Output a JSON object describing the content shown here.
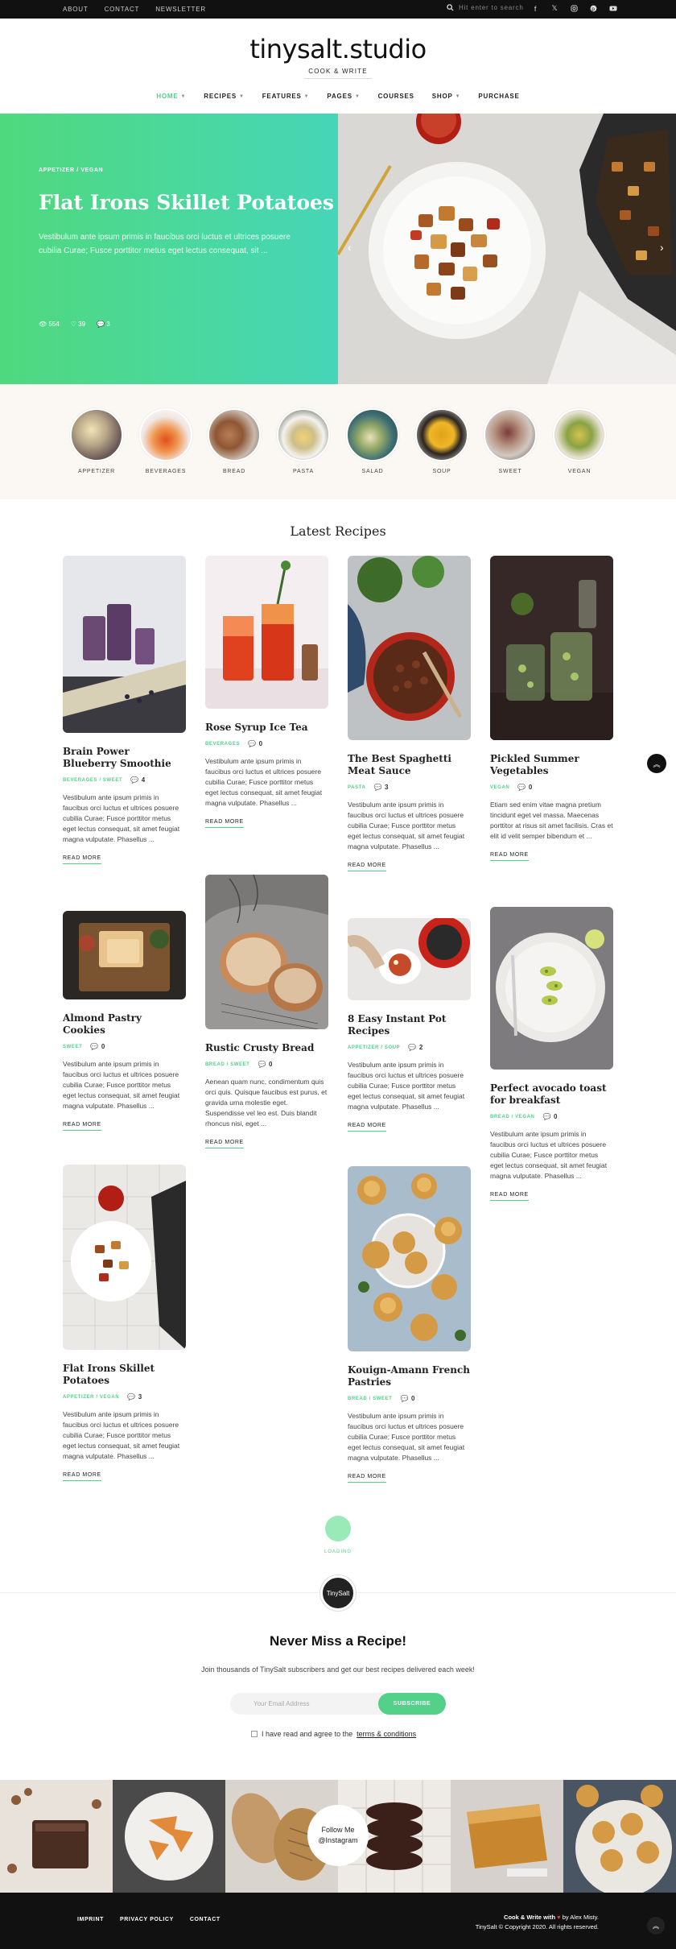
{
  "topbar": {
    "links": [
      "ABOUT",
      "CONTACT",
      "NEWSLETTER"
    ],
    "search_placeholder": "Hit enter to search"
  },
  "header": {
    "logo": "tinysalt.studio",
    "tagline": "COOK & WRITE"
  },
  "nav": [
    {
      "label": "HOME",
      "dropdown": true,
      "active": true
    },
    {
      "label": "RECIPES",
      "dropdown": true
    },
    {
      "label": "FEATURES",
      "dropdown": true
    },
    {
      "label": "PAGES",
      "dropdown": true
    },
    {
      "label": "COURSES",
      "dropdown": false
    },
    {
      "label": "SHOP",
      "dropdown": true
    },
    {
      "label": "PURCHASE",
      "dropdown": false
    }
  ],
  "hero": {
    "category": "APPETIZER / VEGAN",
    "title": "Flat Irons Skillet Potatoes",
    "excerpt": "Vestibulum ante ipsum primis in faucibus orci luctus et ultrices posuere cubilia Curae; Fusce porttitor metus eget lectus consequat, sit ...",
    "views": "554",
    "likes": "39",
    "comments": "3"
  },
  "categories": [
    "APPETIZER",
    "BEVERAGES",
    "BREAD",
    "PASTA",
    "SALAD",
    "SOUP",
    "SWEET",
    "VEGAN"
  ],
  "latest": {
    "title": "Latest Recipes",
    "read_more": "READ MORE",
    "cards": [
      {
        "title": "Brain Power Blueberry Smoothie",
        "category": "BEVERAGES / SWEET",
        "comments": "4",
        "excerpt": "Vestibulum ante ipsum primis in faucibus orci luctus et ultrices posuere cubilia Curae; Fusce porttitor metus eget lectus consequat, sit amet feugiat magna vulputate. Phasellus ..."
      },
      {
        "title": "Rose Syrup Ice Tea",
        "category": "BEVERAGES",
        "comments": "0",
        "excerpt": "Vestibulum ante ipsum primis in faucibus orci luctus et ultrices posuere cubilia Curae; Fusce porttitor metus eget lectus consequat, sit amet feugiat magna vulputate. Phasellus ..."
      },
      {
        "title": "The Best Spaghetti Meat Sauce",
        "category": "PASTA",
        "comments": "3",
        "excerpt": "Vestibulum ante ipsum primis in faucibus orci luctus et ultrices posuere cubilia Curae; Fusce porttitor metus eget lectus consequat, sit amet feugiat magna vulputate. Phasellus ..."
      },
      {
        "title": "Pickled Summer Vegetables",
        "category": "VEGAN",
        "comments": "0",
        "excerpt": "Etiam sed enim vitae magna pretium tincidunt eget vel massa. Maecenas porttitor at risus sit amet facilisis. Cras et elit id velit semper bibendum et ..."
      },
      {
        "title": "Almond Pastry Cookies",
        "category": "SWEET",
        "comments": "0",
        "excerpt": "Vestibulum ante ipsum primis in faucibus orci luctus et ultrices posuere cubilia Curae; Fusce porttitor metus eget lectus consequat, sit amet feugiat magna vulputate. Phasellus ..."
      },
      {
        "title": "Rustic Crusty Bread",
        "category": "BREAD / SWEET",
        "comments": "0",
        "excerpt": "Aenean quam nunc, condimentum quis orci quis. Quisque faucibus est purus, et gravida urna molestie eget. Suspendisse vel leo est. Duis blandit rhoncus nisi, eget ..."
      },
      {
        "title": "8 Easy Instant Pot Recipes",
        "category": "APPETIZER / SOUP",
        "comments": "2",
        "excerpt": "Vestibulum ante ipsum primis in faucibus orci luctus et ultrices posuere cubilia Curae; Fusce porttitor metus eget lectus consequat, sit amet feugiat magna vulputate. Phasellus ..."
      },
      {
        "title": "Perfect avocado toast for breakfast",
        "category": "BREAD / VEGAN",
        "comments": "0",
        "excerpt": "Vestibulum ante ipsum primis in faucibus orci luctus et ultrices posuere cubilia Curae; Fusce porttitor metus eget lectus consequat, sit amet feugiat magna vulputate. Phasellus ..."
      },
      {
        "title": "Flat Irons Skillet Potatoes",
        "category": "APPETIZER / VEGAN",
        "comments": "3",
        "excerpt": "Vestibulum ante ipsum primis in faucibus orci luctus et ultrices posuere cubilia Curae; Fusce porttitor metus eget lectus consequat, sit amet feugiat magna vulputate. Phasellus ..."
      },
      {
        "title": "Kouign-Amann French Pastries",
        "category": "BREAD / SWEET",
        "comments": "0",
        "excerpt": "Vestibulum ante ipsum primis in faucibus orci luctus et ultrices posuere cubilia Curae; Fusce porttitor metus eget lectus consequat, sit amet feugiat magna vulputate. Phasellus ..."
      }
    ]
  },
  "loading_text": "LOADING",
  "badge_text": "TinySalt",
  "newsletter": {
    "title": "Never Miss a Recipe!",
    "text": "Join thousands of TinySalt subscribers and get our best recipes delivered each week!",
    "placeholder": "Your Email Address",
    "button": "SUBSCRIBE",
    "agree": "I have read and agree to the",
    "terms": "terms & conditions"
  },
  "instagram": {
    "follow_line1": "Follow Me",
    "follow_line2": "@Instagram"
  },
  "footer": {
    "links": [
      "IMPRINT",
      "PRIVACY POLICY",
      "CONTACT"
    ],
    "credit_line1a": "Cook & Write with",
    "credit_line1b": "by Alex Misty.",
    "credit_line2": "TinySalt © Copyright 2020. All rights reserved."
  },
  "colors": {
    "accent": "#53d189",
    "dark": "#111111"
  }
}
